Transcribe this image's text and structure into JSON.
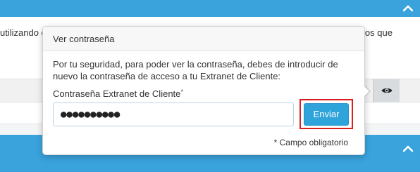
{
  "background": {
    "text_left": "utilizando el",
    "text_right": "ios que",
    "text_right2": "",
    "collapse_icon": "chevron-up-icon",
    "eye_icon": "eye-icon"
  },
  "popover": {
    "title": "Ver contraseña",
    "intro": "Por tu seguridad, para poder ver la contraseña, debes de introducir de nuevo la contraseña de acceso a tu Extranet de Cliente:",
    "field_label": "Contraseña Extranet de Cliente",
    "required_mark": "*",
    "password_value": "●●●●●●●●●●",
    "submit_label": "Enviar",
    "required_note": "* Campo obligatorio"
  },
  "colors": {
    "brand_blue": "#3aa3dc",
    "button_blue": "#2fa4da",
    "highlight_red": "#d81e1e"
  }
}
